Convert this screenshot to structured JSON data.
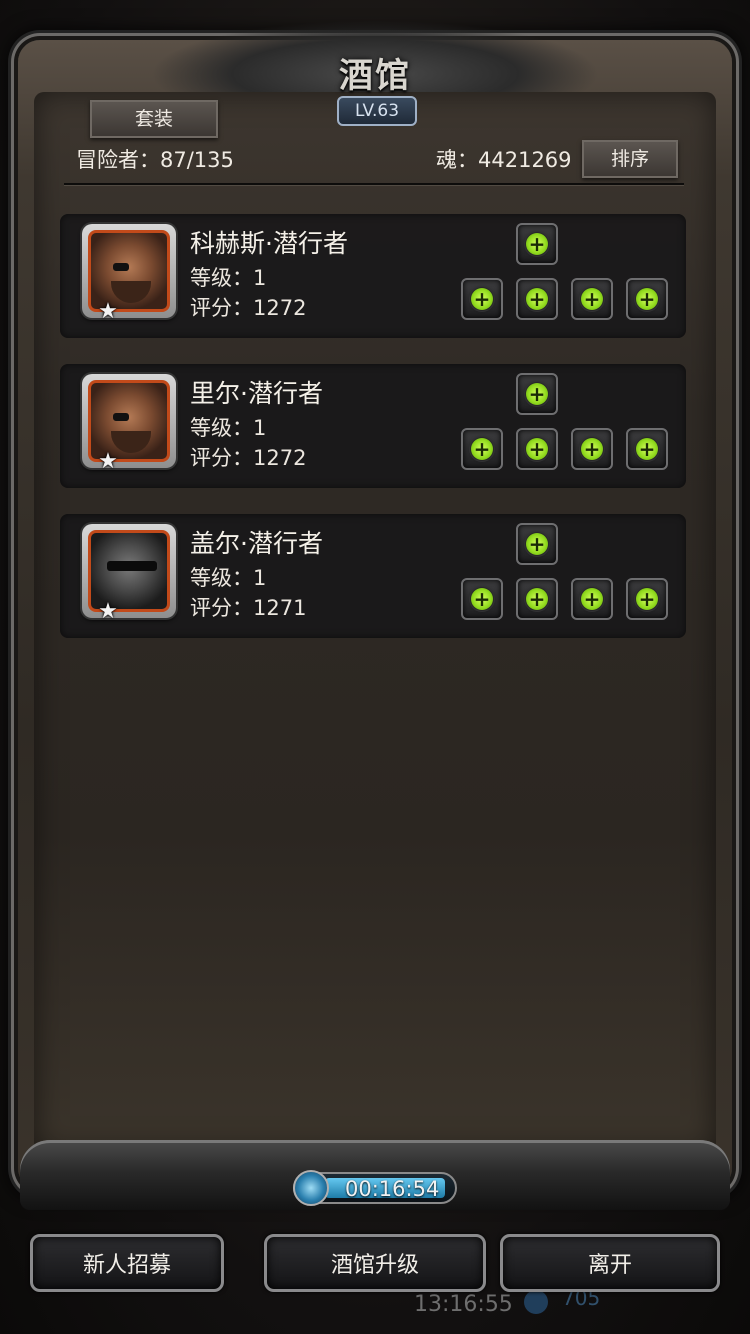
{
  "header": {
    "title": "酒馆",
    "level": "LV.63",
    "set_button": "套装",
    "sort_button": "排序",
    "adventurers": "冒险者：87/135",
    "soul": "魂：4421269"
  },
  "heroes": [
    {
      "name": "科赫斯·潜行者",
      "level": "等级：1",
      "score": "评分：1272"
    },
    {
      "name": "里尔·潜行者",
      "level": "等级：1",
      "score": "评分：1272"
    },
    {
      "name": "盖尔·潜行者",
      "level": "等级：1",
      "score": "评分：1271"
    }
  ],
  "timer": "00:16:54",
  "actions": {
    "recruit": "新人招募",
    "upgrade": "酒馆升级",
    "leave": "离开"
  },
  "background": {
    "clock": "13:16:55",
    "gem_value": "705"
  },
  "icons": {
    "slot_add": "plus-icon",
    "hero_rank": "star-icon",
    "timer": "clock-icon"
  },
  "colors": {
    "plus_green": "#8fd91c",
    "portrait_border": "#c24a1a",
    "level_badge": "#9fb0c6",
    "timer_fill": "#65c8f0"
  }
}
